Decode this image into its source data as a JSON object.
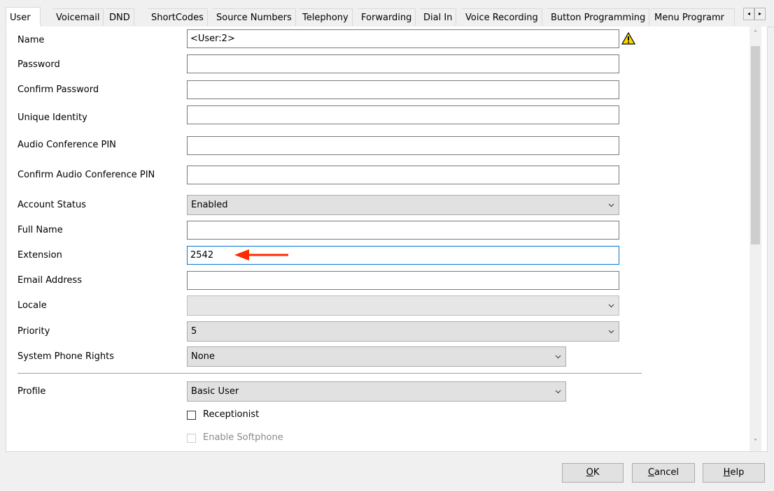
{
  "tabs": [
    "User",
    "Voicemail",
    "DND",
    "ShortCodes",
    "Source Numbers",
    "Telephony",
    "Forwarding",
    "Dial In",
    "Voice Recording",
    "Button Programming",
    "Menu Programr"
  ],
  "active_tab": "User",
  "tab_scroll": {
    "left": "◂",
    "right": "▸"
  },
  "form": {
    "name": {
      "label": "Name",
      "value": "<User:2>"
    },
    "password": {
      "label": "Password",
      "value": ""
    },
    "confirm_password": {
      "label": "Confirm Password",
      "value": ""
    },
    "unique_identity": {
      "label": "Unique Identity",
      "value": ""
    },
    "audio_conf_pin": {
      "label": "Audio Conference PIN",
      "value": ""
    },
    "confirm_audio_conf_pin": {
      "label": "Confirm Audio Conference PIN",
      "value": ""
    },
    "account_status": {
      "label": "Account Status",
      "value": "Enabled"
    },
    "full_name": {
      "label": "Full Name",
      "value": ""
    },
    "extension": {
      "label": "Extension",
      "value": "2542"
    },
    "email": {
      "label": "Email Address",
      "value": ""
    },
    "locale": {
      "label": "Locale",
      "value": ""
    },
    "priority": {
      "label": "Priority",
      "value": "5"
    },
    "system_phone_rights": {
      "label": "System Phone Rights",
      "value": "None"
    },
    "profile": {
      "label": "Profile",
      "value": "Basic User"
    },
    "receptionist": {
      "label": "Receptionist",
      "checked": false
    },
    "enable_softphone": {
      "label": "Enable Softphone",
      "checked": false,
      "enabled": false
    }
  },
  "scroll": {
    "up": "˄",
    "down": "˅"
  },
  "buttons": {
    "ok": {
      "u": "O",
      "rest": "K"
    },
    "cancel": {
      "u": "C",
      "rest": "ancel"
    },
    "help": {
      "u": "H",
      "rest": "elp"
    }
  },
  "colors": {
    "annotation_arrow": "#ff2a00",
    "focus_border": "#0078d7",
    "warning": "#ffd800"
  }
}
